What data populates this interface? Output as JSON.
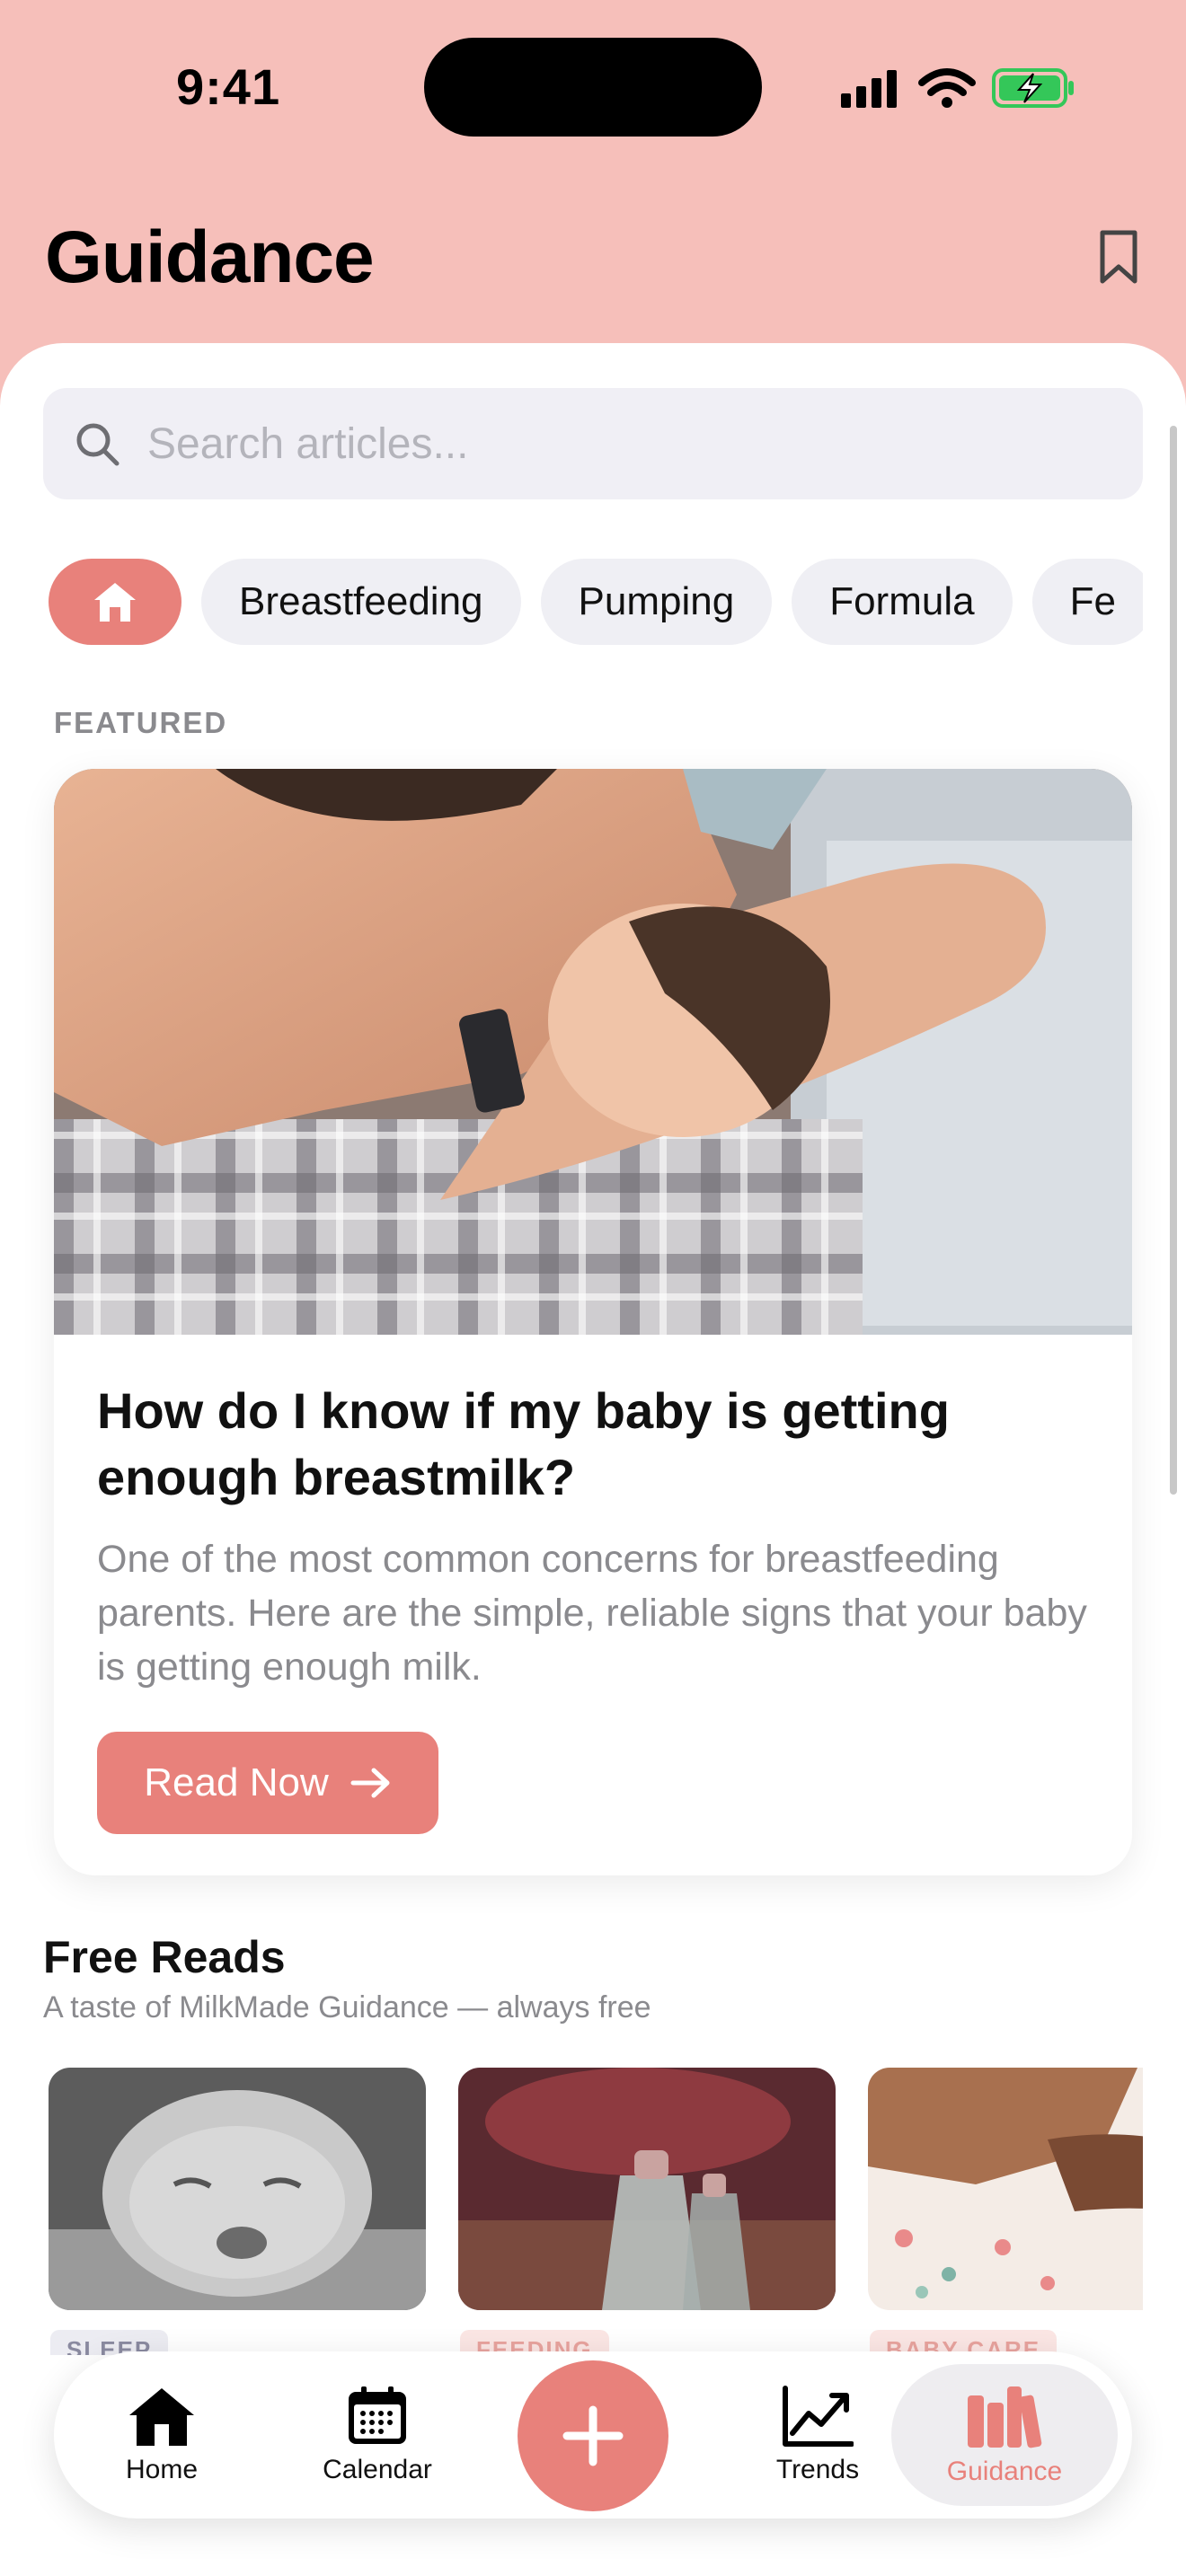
{
  "status_bar": {
    "time": "9:41"
  },
  "header": {
    "title": "Guidance"
  },
  "search": {
    "placeholder": "Search articles..."
  },
  "categories": [
    "Breastfeeding",
    "Pumping",
    "Formula",
    "Fe"
  ],
  "featured": {
    "section_label": "FEATURED",
    "title": "How do I know if my baby is getting enough breastmilk?",
    "description": "One of the most common concerns for breastfeeding parents. Here are the simple, reliable signs that your baby is getting enough milk.",
    "button_label": "Read Now"
  },
  "free_reads": {
    "title": "Free Reads",
    "subtitle": "A taste of MilkMade Guidance — always free",
    "items": [
      {
        "tag": "SLEEP"
      },
      {
        "tag": "FEEDING"
      },
      {
        "tag": "BABY CARE"
      }
    ]
  },
  "tabbar": {
    "home": "Home",
    "calendar": "Calendar",
    "trends": "Trends",
    "guidance": "Guidance"
  },
  "colors": {
    "accent": "#e8817b",
    "header_bg": "#f6bfba",
    "chip_bg": "#efeff4",
    "muted_text": "#8a8a8e"
  }
}
